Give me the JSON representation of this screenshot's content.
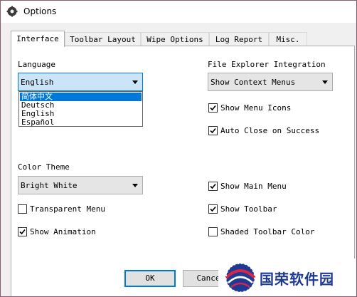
{
  "window": {
    "title": "Options"
  },
  "tabs": [
    {
      "label": "Interface",
      "active": true
    },
    {
      "label": "Toolbar Layout"
    },
    {
      "label": "Wipe Options"
    },
    {
      "label": "Log Report"
    },
    {
      "label": "Misc."
    }
  ],
  "language": {
    "label": "Language",
    "selected": "English",
    "options": [
      "简体中文",
      "Deutsch",
      "English",
      "Español"
    ],
    "highlighted_option": "简体中文"
  },
  "file_explorer": {
    "label": "File Explorer Integration",
    "selected": "Show Context Menus",
    "show_menu_icons": {
      "label": "Show Menu Icons",
      "checked": true
    },
    "auto_close": {
      "label": "Auto Close on Success",
      "checked": true
    }
  },
  "color_theme": {
    "label": "Color Theme",
    "selected": "Bright White"
  },
  "checkboxes": {
    "transparent_menu": {
      "label": "Transparent Menu",
      "checked": false
    },
    "show_animation": {
      "label": "Show Animation",
      "checked": true
    },
    "show_main_menu": {
      "label": "Show Main Menu",
      "checked": true
    },
    "show_toolbar": {
      "label": "Show Toolbar",
      "checked": true
    },
    "shaded_toolbar_color": {
      "label": "Shaded Toolbar Color",
      "checked": false
    }
  },
  "buttons": {
    "ok": "OK",
    "cancel": "Cance"
  },
  "watermark": {
    "text": "国荣软件园"
  },
  "colors": {
    "accent": "#0078d7",
    "selection_bg": "#cce4f7",
    "watermark": "#1f3a93"
  }
}
